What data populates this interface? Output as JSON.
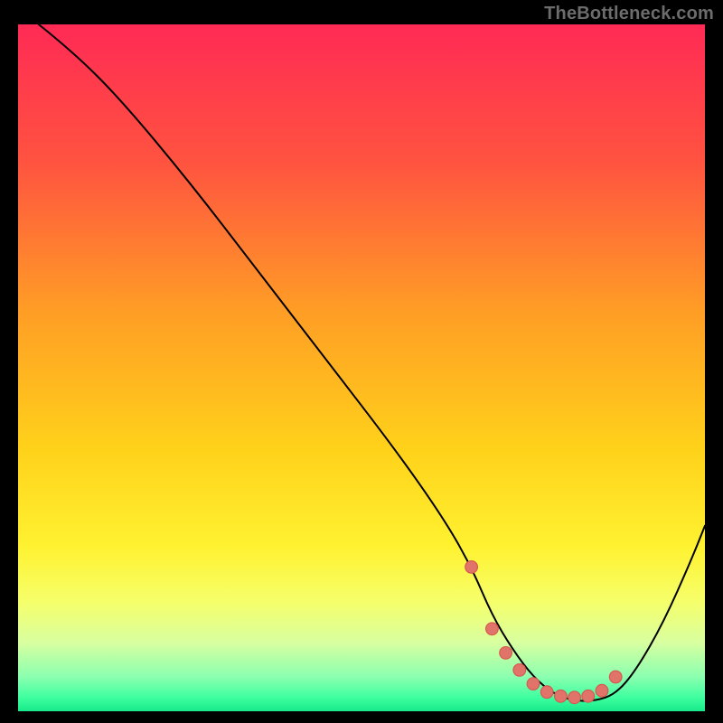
{
  "watermark": "TheBottleneck.com",
  "colors": {
    "bg": "#000000",
    "curve": "#000000",
    "marker_fill": "#e0746b",
    "marker_stroke": "#d9564e"
  },
  "chart_data": {
    "type": "line",
    "title": "",
    "xlabel": "",
    "ylabel": "",
    "xlim": [
      0,
      100
    ],
    "ylim": [
      0,
      100
    ],
    "gradient_stops": [
      {
        "offset": 0,
        "color": "#ff2a55"
      },
      {
        "offset": 20,
        "color": "#ff5340"
      },
      {
        "offset": 42,
        "color": "#ff9e25"
      },
      {
        "offset": 62,
        "color": "#ffd21a"
      },
      {
        "offset": 76,
        "color": "#fff230"
      },
      {
        "offset": 84,
        "color": "#f6ff6a"
      },
      {
        "offset": 90,
        "color": "#d8ffa0"
      },
      {
        "offset": 95,
        "color": "#8bffb0"
      },
      {
        "offset": 98,
        "color": "#3effa0"
      },
      {
        "offset": 100,
        "color": "#18e98a"
      }
    ],
    "series": [
      {
        "name": "bottleneck-curve",
        "x": [
          3,
          8,
          15,
          25,
          35,
          45,
          55,
          62,
          66,
          69,
          72,
          75,
          78,
          81,
          84,
          87,
          90,
          94,
          98,
          100
        ],
        "y": [
          100,
          96,
          89,
          77,
          64,
          51,
          38,
          28,
          21,
          14,
          9,
          5,
          2.5,
          1.5,
          1.5,
          2.5,
          6,
          13,
          22,
          27
        ]
      }
    ],
    "markers": {
      "name": "optimal-range",
      "x": [
        66,
        69,
        71,
        73,
        75,
        77,
        79,
        81,
        83,
        85,
        87
      ],
      "y": [
        21,
        12,
        8.5,
        6,
        4,
        2.8,
        2.2,
        2,
        2.2,
        3,
        5
      ]
    }
  }
}
